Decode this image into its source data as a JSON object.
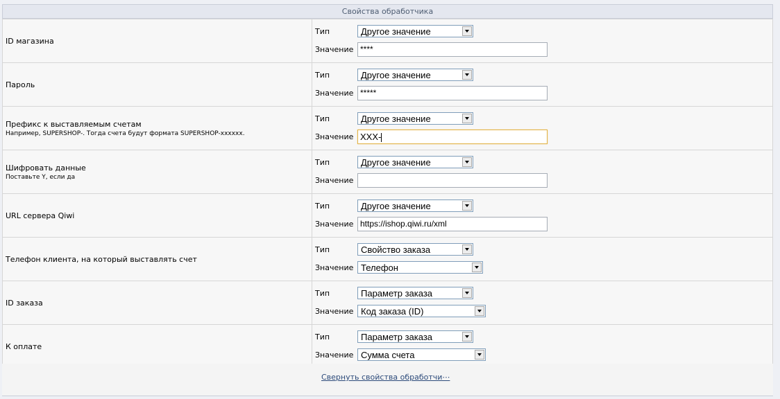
{
  "header": {
    "title": "Свойства обработчика"
  },
  "common": {
    "type_label": "Тип",
    "value_label": "Значение"
  },
  "rows": [
    {
      "label": "ID магазина",
      "hint": "",
      "type": "Другое значение",
      "value": "****",
      "value_kind": "input"
    },
    {
      "label": "Пароль",
      "hint": "",
      "type": "Другое значение",
      "value": "*****",
      "value_kind": "input"
    },
    {
      "label": "Префикс к выставляемым счетам",
      "hint": "Например, SUPERSHOP-. Тогда счета будут формата SUPERSHOP-xxxxxx.",
      "type": "Другое значение",
      "value": "XXX-",
      "value_kind": "input",
      "focused": true
    },
    {
      "label": "Шифровать данные",
      "hint": "Поставьте Y, если да",
      "type": "Другое значение",
      "value": "",
      "value_kind": "input"
    },
    {
      "label": "URL сервера Qiwi",
      "hint": "",
      "type": "Другое значение",
      "value": "https://ishop.qiwi.ru/xml",
      "value_kind": "input"
    },
    {
      "label": "Телефон клиента, на который выставлять счет",
      "hint": "",
      "type": "Свойство заказа",
      "value": "Телефон",
      "value_kind": "select"
    },
    {
      "label": "ID заказа",
      "hint": "",
      "type": "Параметр заказа",
      "value": "Код заказа (ID)",
      "value_kind": "select"
    },
    {
      "label": "К оплате",
      "hint": "",
      "type": "Параметр заказа",
      "value": "Сумма счета",
      "value_kind": "select"
    }
  ],
  "footer": {
    "collapse_label": "Свернуть свойства обработчи⋯"
  }
}
